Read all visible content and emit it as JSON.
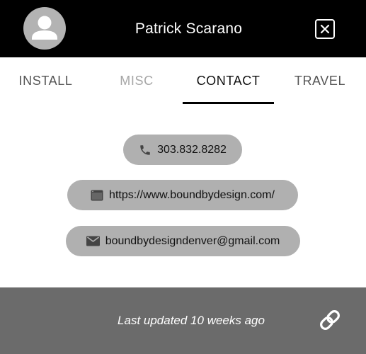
{
  "header": {
    "name": "Patrick Scarano",
    "avatar_icon": "person-icon",
    "close_icon": "close-icon"
  },
  "tabs": [
    {
      "label": "INSTALL",
      "state": "normal"
    },
    {
      "label": "MISC",
      "state": "disabled"
    },
    {
      "label": "CONTACT",
      "state": "active"
    },
    {
      "label": "TRAVEL",
      "state": "normal"
    }
  ],
  "contacts": {
    "phone": {
      "icon": "phone-icon",
      "value": "303.832.8282"
    },
    "website": {
      "icon": "browser-window-icon",
      "value": "https://www.boundbydesign.com/"
    },
    "email": {
      "icon": "envelope-icon",
      "value": "boundbydesigndenver@gmail.com"
    }
  },
  "footer": {
    "updated_text": "Last updated 10 weeks ago",
    "link_icon": "link-icon"
  },
  "colors": {
    "header_bg": "#000000",
    "chip_bg": "#b0b0b0",
    "footer_bg": "#6b6b6b",
    "active_tab_underline": "#000000"
  }
}
